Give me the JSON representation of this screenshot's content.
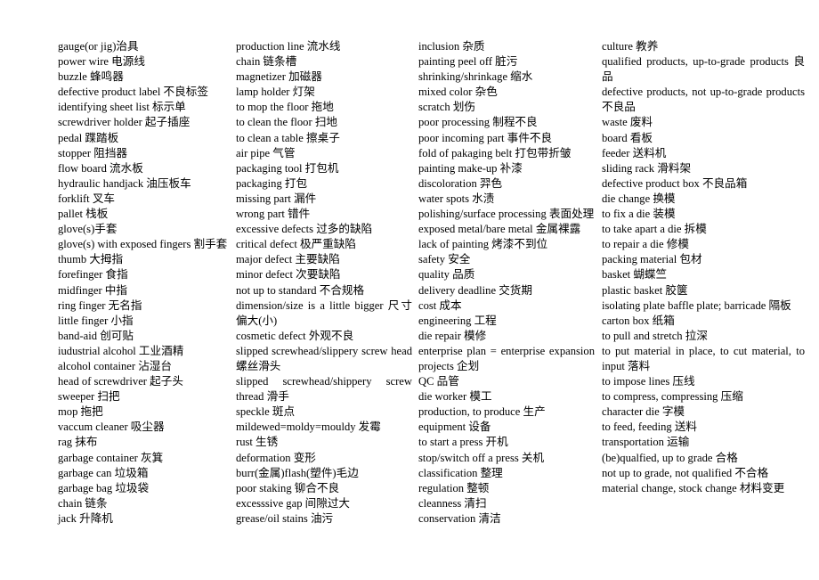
{
  "document": {
    "title": "Factory / Quality Control English-Chinese Glossary",
    "page_background": "#ffffff",
    "text_color": "#000000",
    "layout": "four-column glossary list"
  },
  "columns": [
    {
      "id": "column-1",
      "entries": [
        {
          "text": "gauge(or jig)治具",
          "spread": false
        },
        {
          "text": "power wire 电源线",
          "spread": false
        },
        {
          "text": "buzzle 蜂鸣器",
          "spread": false
        },
        {
          "text": "defective product label 不良标签",
          "spread": false
        },
        {
          "text": "identifying sheet list 标示单",
          "spread": false
        },
        {
          "text": "screwdriver holder 起子插座",
          "spread": false
        },
        {
          "text": "pedal 蹀踏板",
          "spread": false
        },
        {
          "text": "stopper 阻挡器",
          "spread": false
        },
        {
          "text": "flow board 流水板",
          "spread": false
        },
        {
          "text": "hydraulic handjack 油压板车",
          "spread": false
        },
        {
          "text": "forklift 叉车",
          "spread": false
        },
        {
          "text": "pallet 栈板",
          "spread": false
        },
        {
          "text": "glove(s)手套",
          "spread": false
        },
        {
          "text": "glove(s) with exposed fingers 割手套",
          "spread": false
        },
        {
          "text": "thumb 大拇指",
          "spread": false
        },
        {
          "text": "forefinger 食指",
          "spread": false
        },
        {
          "text": "midfinger 中指",
          "spread": false
        },
        {
          "text": "ring finger 无名指",
          "spread": false
        },
        {
          "text": "little finger 小指",
          "spread": false
        },
        {
          "text": "band-aid 创可贴",
          "spread": false
        },
        {
          "text": "iudustrial alcohol 工业酒精",
          "spread": false
        },
        {
          "text": "alcohol container 沾湿台",
          "spread": false
        },
        {
          "text": "head of screwdriver 起子头",
          "spread": false
        },
        {
          "text": "sweeper 扫把",
          "spread": false
        },
        {
          "text": "mop 拖把",
          "spread": false
        },
        {
          "text": "vaccum cleaner 吸尘器",
          "spread": false
        },
        {
          "text": "rag  抹布",
          "spread": false
        },
        {
          "text": "garbage container 灰箕",
          "spread": false
        },
        {
          "text": "garbage can 垃圾箱",
          "spread": false
        },
        {
          "text": "garbage bag 垃圾袋",
          "spread": false
        },
        {
          "text": "chain 链条",
          "spread": false
        },
        {
          "text": "jack 升降机",
          "spread": false
        }
      ]
    },
    {
      "id": "column-2",
      "entries": [
        {
          "text": "production line 流水线",
          "spread": false
        },
        {
          "text": "chain 链条槽",
          "spread": false
        },
        {
          "text": "magnetizer 加磁器",
          "spread": false
        },
        {
          "text": "lamp holder 灯架",
          "spread": false
        },
        {
          "text": "to mop the floor 拖地",
          "spread": false
        },
        {
          "text": "to clean the floor 扫地",
          "spread": false
        },
        {
          "text": "to clean a table 擦桌子",
          "spread": false
        },
        {
          "text": "air pipe  气管",
          "spread": false
        },
        {
          "text": "packaging tool 打包机",
          "spread": false
        },
        {
          "text": "packaging 打包",
          "spread": false
        },
        {
          "text": "missing part 漏件",
          "spread": false
        },
        {
          "text": "wrong part 错件",
          "spread": false
        },
        {
          "text": "excessive defects 过多的缺陷",
          "spread": false
        },
        {
          "text": "critical defect 极严重缺陷",
          "spread": false
        },
        {
          "text": "major defect 主要缺陷",
          "spread": false
        },
        {
          "text": "minor defect 次要缺陷",
          "spread": false
        },
        {
          "text": "not up to standard 不合规格",
          "spread": false
        },
        {
          "text": "dimension/size is a little bigger 尺寸偏大(小)",
          "spread": false,
          "wrapped": true
        },
        {
          "text": "cosmetic defect 外观不良",
          "spread": false
        },
        {
          "text": "slipped screwhead/slippery screw head 螺丝滑头",
          "spread": false,
          "wrapped": true
        },
        {
          "text": "slipped screwhead/shippery screw thread 滑手",
          "spread": false,
          "wrapped": true,
          "justify_lines": true
        },
        {
          "text": "speckle 斑点",
          "spread": false
        },
        {
          "text": "mildewed=moldy=mouldy 发霉",
          "spread": false
        },
        {
          "text": "rust 生锈",
          "spread": false
        },
        {
          "text": "deformation 变形",
          "spread": false
        },
        {
          "text": "burr(金属)flash(塑件)毛边",
          "spread": false
        },
        {
          "text": "poor staking 铆合不良",
          "spread": false
        },
        {
          "text": "excesssive gap 间隙过大",
          "spread": false
        },
        {
          "text": "grease/oil stains 油污",
          "spread": false
        }
      ]
    },
    {
      "id": "column-3",
      "entries": [
        {
          "text": "inclusion 杂质",
          "spread": false
        },
        {
          "text": "painting peel off 脏污",
          "spread": false
        },
        {
          "text": "shrinking/shrinkage 缩水",
          "spread": false
        },
        {
          "text": "mixed color 杂色",
          "spread": false
        },
        {
          "text": "scratch 划伤",
          "spread": false
        },
        {
          "text": "poor processing  制程不良",
          "spread": false
        },
        {
          "text": "poor incoming part 事件不良",
          "spread": false
        },
        {
          "text": "fold of pakaging belt 打包带折皱",
          "spread": false
        },
        {
          "text": "painting make-up 补漆",
          "spread": false
        },
        {
          "text": "discoloration 羿色",
          "spread": false
        },
        {
          "text": "water spots 水渍",
          "spread": false
        },
        {
          "text": "polishing/surface processing 表面处理",
          "spread": false
        },
        {
          "text": "exposed metal/bare metal 金属裸露",
          "spread": false
        },
        {
          "text": "lack of painting 烤漆不到位",
          "spread": false
        },
        {
          "text": "safety 安全",
          "spread": false
        },
        {
          "text": "quality 品质",
          "spread": false
        },
        {
          "text": "delivery deadline 交货期",
          "spread": false
        },
        {
          "text": "cost 成本",
          "spread": false
        },
        {
          "text": "engineering 工程",
          "spread": false
        },
        {
          "text": "die repair 模修",
          "spread": false
        },
        {
          "text": "enterprise plan = enterprise expansion projects 企划",
          "spread": false,
          "wrapped": true,
          "justify_lines": true
        },
        {
          "text": "QC 品管",
          "spread": false
        },
        {
          "text": "die worker 模工",
          "spread": false
        },
        {
          "text": "production, to produce 生产",
          "spread": false
        },
        {
          "text": "equipment 设备",
          "spread": false
        },
        {
          "text": "to start a press 开机",
          "spread": false
        },
        {
          "text": "stop/switch off a press 关机",
          "spread": false
        },
        {
          "text": "classification 整理",
          "spread": false
        },
        {
          "text": "regulation 整顿",
          "spread": false
        },
        {
          "text": "cleanness 清扫",
          "spread": false
        },
        {
          "text": "conservation 清洁",
          "spread": false
        }
      ]
    },
    {
      "id": "column-4",
      "entries": [
        {
          "text": "culture 教养",
          "spread": false
        },
        {
          "text": "qualified products, up-to-grade products 良品",
          "spread": false,
          "wrapped": true,
          "justify_lines": true
        },
        {
          "text": "defective products, not up-to-grade products 不良品",
          "spread": false,
          "wrapped": true,
          "justify_lines": true
        },
        {
          "text": "waste 废料",
          "spread": false
        },
        {
          "text": "board 看板",
          "spread": false
        },
        {
          "text": "feeder 送料机",
          "spread": false
        },
        {
          "text": "sliding rack 滑料架",
          "spread": false
        },
        {
          "text": "defective product box 不良品箱",
          "spread": false
        },
        {
          "text": "die change  换模",
          "spread": false
        },
        {
          "text": "to fix a die 装模",
          "spread": false
        },
        {
          "text": "to take apart a die 拆模",
          "spread": false
        },
        {
          "text": "to repair a die 修模",
          "spread": false
        },
        {
          "text": "packing material 包材",
          "spread": false
        },
        {
          "text": "basket 蝴蝶竺",
          "spread": false
        },
        {
          "text": "plastic basket 胶箧",
          "spread": false
        },
        {
          "text": "isolating plate baffle plate; barricade 隔板",
          "spread": false,
          "wrapped": true,
          "justify_lines": true
        },
        {
          "text": "carton box 纸箱",
          "spread": false
        },
        {
          "text": "to pull and stretch 拉深",
          "spread": false
        },
        {
          "text": "to put material in place, to cut material, to input 落料",
          "spread": false,
          "wrapped": true
        },
        {
          "text": "to impose lines 压线",
          "spread": false
        },
        {
          "text": "to compress, compressing 压缩",
          "spread": false
        },
        {
          "text": "character die 字模",
          "spread": false
        },
        {
          "text": "to feed, feeding 送料",
          "spread": false
        },
        {
          "text": "transportation 运输",
          "spread": false
        },
        {
          "text": "(be)qualfied, up to grade 合格",
          "spread": false
        },
        {
          "text": "not up to grade, not qualified 不合格",
          "spread": false
        },
        {
          "text": "material change, stock change 材料变更",
          "spread": false,
          "wrapped": true,
          "justify_lines": true
        }
      ]
    }
  ]
}
